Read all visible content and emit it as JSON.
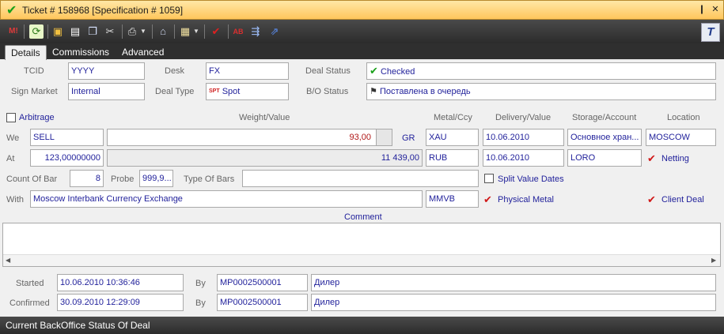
{
  "window": {
    "title": "Ticket # 158968 [Specification # 1059]",
    "pin_glyph": "❙",
    "close_glyph": "✕"
  },
  "toolbar": {
    "app_logo_text": "T"
  },
  "tabs": [
    "Details",
    "Commissions",
    "Advanced"
  ],
  "header": {
    "tcid_label": "TCID",
    "tcid_value": "YYYY",
    "desk_label": "Desk",
    "desk_value": "FX",
    "deal_status_label": "Deal Status",
    "deal_status_value": "Checked",
    "sign_market_label": "Sign Market",
    "sign_market_value": "Internal",
    "deal_type_label": "Deal Type",
    "deal_type_value": "Spot",
    "deal_type_badge": "SPT",
    "bo_status_label": "B/O Status",
    "bo_status_value": "Поставлена в очередь"
  },
  "grid": {
    "arbitrage_label": "Arbitrage",
    "col_weight": "Weight/Value",
    "col_metal": "Metal/Ccy",
    "col_delivery": "Delivery/Value",
    "col_storage": "Storage/Account",
    "col_location": "Location",
    "we_label": "We",
    "we_side": "SELL",
    "we_amount": "93,00",
    "we_unit": "GR",
    "we_metal": "XAU",
    "we_delivery": "10.06.2010",
    "we_storage": "Основное хран...",
    "we_location": "MOSCOW",
    "at_label": "At",
    "at_price": "123,00000000",
    "at_total": "11 439,00",
    "at_ccy": "RUB",
    "at_value_date": "10.06.2010",
    "at_account": "LORO",
    "netting_label": "Netting",
    "count_label": "Count Of Bar",
    "count_value": "8",
    "probe_label": "Probe",
    "probe_value": "999,9...",
    "type_bars_label": "Type Of Bars",
    "split_label": "Split Value Dates",
    "with_label": "With",
    "with_value": "Moscow Interbank Currency Exchange",
    "with_code": "MMVB",
    "physical_label": "Physical Metal",
    "client_deal_label": "Client Deal"
  },
  "comment": {
    "label": "Comment"
  },
  "audit": {
    "started_label": "Started",
    "started_time": "10.06.2010 10:36:46",
    "started_by_label": "By",
    "started_by": "MP0002500001",
    "started_role": "Дилер",
    "confirmed_label": "Confirmed",
    "confirmed_time": "30.09.2010 12:29:09",
    "confirmed_by_label": "By",
    "confirmed_by": "MP0002500001",
    "confirmed_role": "Дилер"
  },
  "status_bar": {
    "text": "Current BackOffice Status Of Deal"
  },
  "colors": {
    "title_bg": "#ffc65c",
    "toolbar_bg": "#3a3a3a",
    "value_blue": "#1f1f9a",
    "amount_red": "#b01818",
    "check_green": "#1aa01a"
  }
}
